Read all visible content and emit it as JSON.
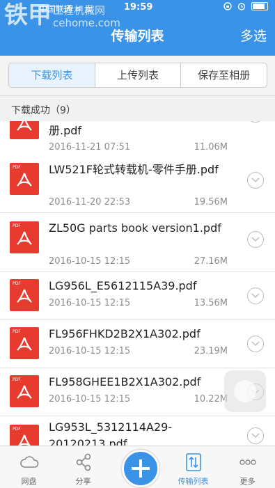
{
  "status_bar": {
    "carrier": "中国联通 ≋ 卖",
    "time": "19:59"
  },
  "watermark": {
    "brand": "铁甲",
    "site": "工程机械网",
    "domain": "cehome.com"
  },
  "header": {
    "title": "传输列表",
    "action": "多选"
  },
  "segments": [
    "下载列表",
    "上传列表",
    "保存至相册"
  ],
  "section_header": "下载成功（9）",
  "files": [
    {
      "name": "册.pdf",
      "date": "2016-11-21 07:51",
      "size": "11.06M"
    },
    {
      "name": "LW521F轮式转载机-零件手册.pdf",
      "date": "2016-11-20 22:53",
      "size": "19.56M"
    },
    {
      "name": "ZL50G parts book version1.pdf",
      "date": "2016-10-15 12:15",
      "size": "27.16M"
    },
    {
      "name": "LG956L_E5612115A39.pdf",
      "date": "2016-10-15 12:15",
      "size": "13.56M"
    },
    {
      "name": "FL956FHKD2B2X1A302.pdf",
      "date": "2016-10-15 12:15",
      "size": "23.19M"
    },
    {
      "name": "FL958GHEE1B2X1A302.pdf",
      "date": "2016-10-15 12:15",
      "size": "10.22M"
    },
    {
      "name": "LG953L_5312114A29-20120213.pdf",
      "date": "",
      "size": ""
    }
  ],
  "tabs": [
    "网盘",
    "分享",
    "传输列表",
    "更多"
  ],
  "colors": {
    "accent": "#3a93e6",
    "pdf_red": "#e63b2e"
  }
}
